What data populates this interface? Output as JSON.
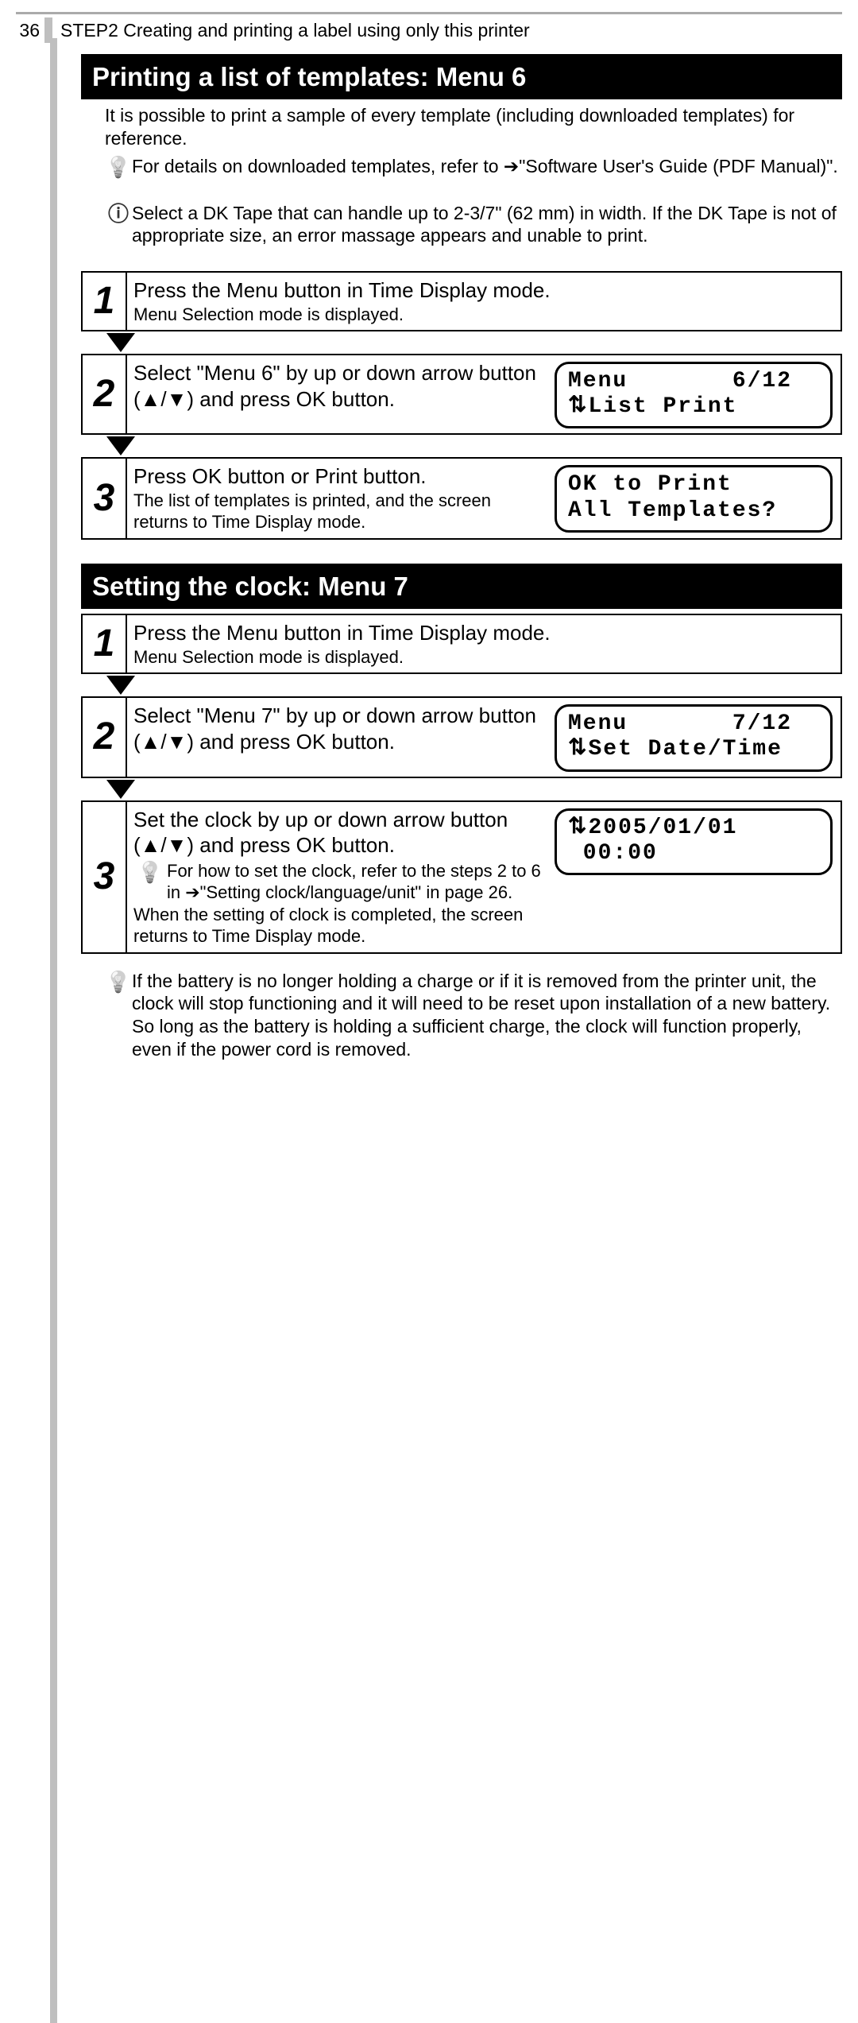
{
  "page_number": "36",
  "header_step": "STEP2 Creating and printing a label using only this printer",
  "section_a": {
    "title": "Printing a list of templates: Menu 6",
    "intro": "It is possible to print a sample of every template (including downloaded templates) for reference.",
    "tip": "For details on downloaded templates, refer to ➔\"Software User's Guide (PDF Manual)\".",
    "caution": "Select a DK Tape that can handle up to 2-3/7\" (62 mm) in width. If the DK Tape is not of appropriate size, an error massage appears and unable to print.",
    "steps": [
      {
        "num": "1",
        "main": "Press the Menu button in Time Display mode.",
        "sub": "Menu Selection mode is displayed.",
        "lcd": null
      },
      {
        "num": "2",
        "main": "Select \"Menu 6\" by up or down arrow button (▲/▼) and press OK button.",
        "sub": "",
        "lcd": "Menu       6/12\n⇅List Print"
      },
      {
        "num": "3",
        "main": "Press OK button or Print button.",
        "sub": "The list of templates is printed, and the screen returns to Time Display mode.",
        "lcd": "OK to Print\nAll Templates?"
      }
    ]
  },
  "section_b": {
    "title": "Setting the clock: Menu 7",
    "steps": [
      {
        "num": "1",
        "main": "Press the Menu button in Time Display mode.",
        "sub": "Menu Selection mode is displayed.",
        "lcd": null
      },
      {
        "num": "2",
        "main": "Select \"Menu 7\" by up or down arrow button (▲/▼) and press OK button.",
        "sub": "",
        "lcd": "Menu       7/12\n⇅Set Date/Time"
      },
      {
        "num": "3",
        "main": "Set the clock by up or down arrow button (▲/▼) and press OK button.",
        "tip": "For how to set the clock, refer to the steps 2 to 6 in ➔\"Setting clock/language/unit\" in page 26.",
        "after": "When the setting of clock is completed, the screen returns to Time Display mode.",
        "lcd": "⇅2005/01/01\n 00:00"
      }
    ],
    "foot_tip": "If the battery is no longer holding a charge or if it is removed from the printer unit, the clock will stop functioning and it will need to be reset upon installation of a new battery. So long as the battery is holding a sufficient charge, the clock will function properly, even if the power cord is removed."
  }
}
